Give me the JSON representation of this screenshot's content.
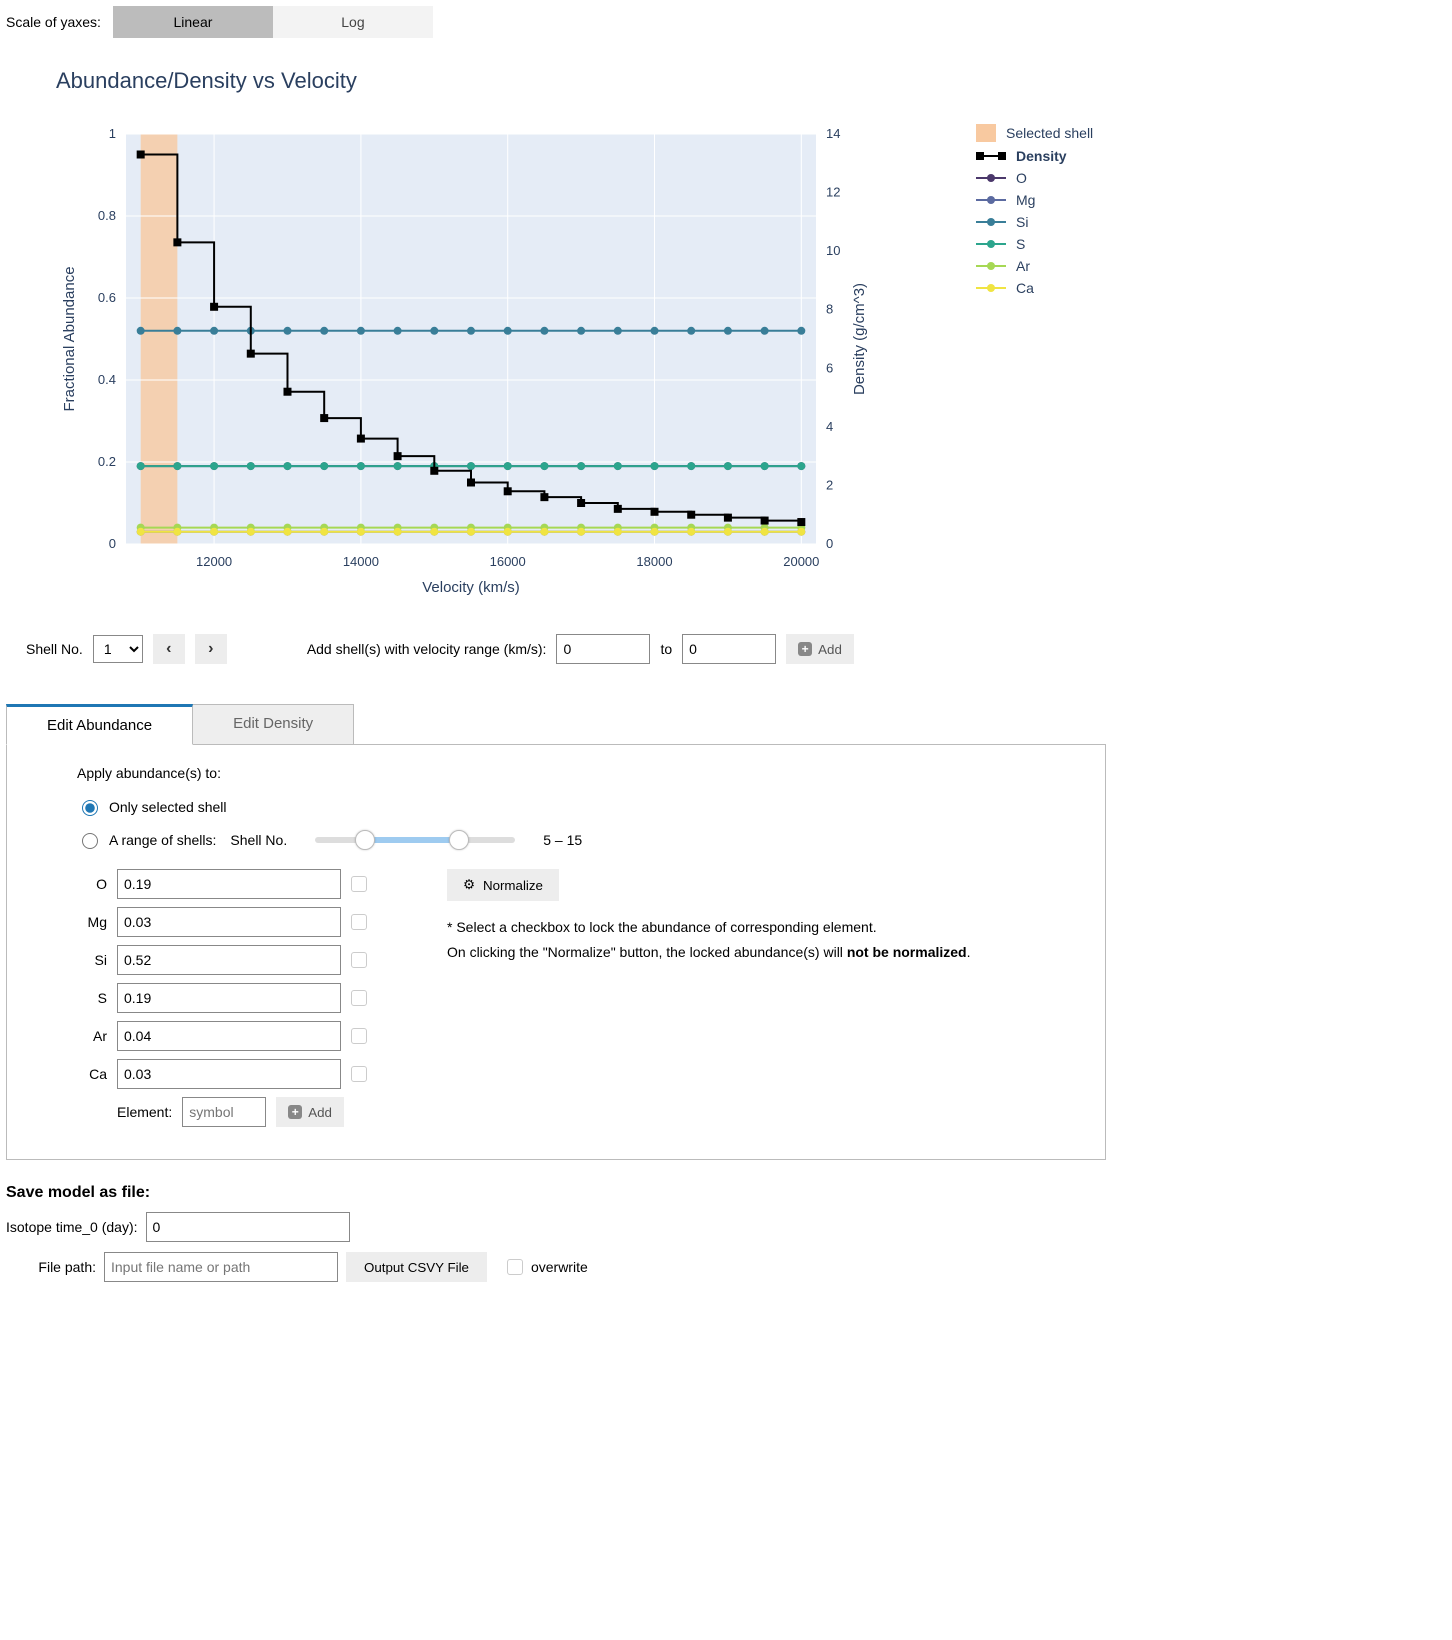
{
  "scale": {
    "label": "Scale of yaxes:",
    "options": [
      "Linear",
      "Log"
    ],
    "active": 0
  },
  "chart": {
    "title": "Abundance/Density vs Velocity",
    "xlabel": "Velocity (km/s)",
    "ylabel_left": "Fractional Abundance",
    "ylabel_right": "Density (g/cm^3)"
  },
  "legend": {
    "selected_shell": "Selected shell",
    "density": "Density",
    "elements": [
      {
        "name": "O",
        "color": "#4b386b"
      },
      {
        "name": "Mg",
        "color": "#5b6aa0"
      },
      {
        "name": "Si",
        "color": "#397e98"
      },
      {
        "name": "S",
        "color": "#2ca58d"
      },
      {
        "name": "Ar",
        "color": "#a6d854"
      },
      {
        "name": "Ca",
        "color": "#f0e442"
      }
    ]
  },
  "shell_controls": {
    "label": "Shell No.",
    "value": "1",
    "add_label": "Add shell(s) with velocity range (km/s):",
    "to": "to",
    "from_val": "0",
    "to_val": "0",
    "add_btn": "Add"
  },
  "tabs": {
    "items": [
      "Edit Abundance",
      "Edit Density"
    ],
    "active": 0
  },
  "edit": {
    "apply_label": "Apply abundance(s) to:",
    "opt_only": "Only selected shell",
    "opt_range": "A range of shells:",
    "range_shell_label": "Shell No.",
    "range_text": "5 – 15",
    "normalize": "Normalize",
    "hint_line1": "* Select a checkbox to lock the abundance of corresponding element.",
    "hint_line2a": "On clicking the \"Normalize\" button, the locked abundance(s) will ",
    "hint_line2b": "not be normalized",
    "hint_line2c": ".",
    "abundances": [
      {
        "el": "O",
        "val": "0.19"
      },
      {
        "el": "Mg",
        "val": "0.03"
      },
      {
        "el": "Si",
        "val": "0.52"
      },
      {
        "el": "S",
        "val": "0.19"
      },
      {
        "el": "Ar",
        "val": "0.04"
      },
      {
        "el": "Ca",
        "val": "0.03"
      }
    ],
    "add_el_label": "Element:",
    "add_el_placeholder": "symbol",
    "add_el_btn": "Add"
  },
  "save": {
    "title": "Save model as file:",
    "isotope_label": "Isotope time_0 (day):",
    "isotope_val": "0",
    "filepath_label": "File path:",
    "filepath_placeholder": "Input file name or path",
    "output_btn": "Output CSVY File",
    "overwrite": "overwrite"
  },
  "chart_data": {
    "type": "line",
    "xlabel": "Velocity (km/s)",
    "ylabel_left": "Fractional Abundance",
    "ylabel_right": "Density (g/cm^3)",
    "xlim": [
      10800,
      20200
    ],
    "ylim_left": [
      0,
      1
    ],
    "ylim_right": [
      0,
      14
    ],
    "x_ticks": [
      12000,
      14000,
      16000,
      18000,
      20000
    ],
    "y_left_ticks": [
      0,
      0.2,
      0.4,
      0.6,
      0.8,
      1
    ],
    "y_right_ticks": [
      0,
      2,
      4,
      6,
      8,
      10,
      12,
      14
    ],
    "selected_shell_x_range": [
      11000,
      11500
    ],
    "x": [
      11000,
      11500,
      12000,
      12500,
      13000,
      13500,
      14000,
      14500,
      15000,
      15500,
      16000,
      16500,
      17000,
      17500,
      18000,
      18500,
      19000,
      19500,
      20000
    ],
    "series_left": [
      {
        "name": "O",
        "color": "#4b386b",
        "values": [
          0.19,
          0.19,
          0.19,
          0.19,
          0.19,
          0.19,
          0.19,
          0.19,
          0.19,
          0.19,
          0.19,
          0.19,
          0.19,
          0.19,
          0.19,
          0.19,
          0.19,
          0.19,
          0.19
        ]
      },
      {
        "name": "Mg",
        "color": "#5b6aa0",
        "values": [
          0.03,
          0.03,
          0.03,
          0.03,
          0.03,
          0.03,
          0.03,
          0.03,
          0.03,
          0.03,
          0.03,
          0.03,
          0.03,
          0.03,
          0.03,
          0.03,
          0.03,
          0.03,
          0.03
        ]
      },
      {
        "name": "Si",
        "color": "#397e98",
        "values": [
          0.52,
          0.52,
          0.52,
          0.52,
          0.52,
          0.52,
          0.52,
          0.52,
          0.52,
          0.52,
          0.52,
          0.52,
          0.52,
          0.52,
          0.52,
          0.52,
          0.52,
          0.52,
          0.52
        ]
      },
      {
        "name": "S",
        "color": "#2ca58d",
        "values": [
          0.19,
          0.19,
          0.19,
          0.19,
          0.19,
          0.19,
          0.19,
          0.19,
          0.19,
          0.19,
          0.19,
          0.19,
          0.19,
          0.19,
          0.19,
          0.19,
          0.19,
          0.19,
          0.19
        ]
      },
      {
        "name": "Ar",
        "color": "#a6d854",
        "values": [
          0.04,
          0.04,
          0.04,
          0.04,
          0.04,
          0.04,
          0.04,
          0.04,
          0.04,
          0.04,
          0.04,
          0.04,
          0.04,
          0.04,
          0.04,
          0.04,
          0.04,
          0.04,
          0.04
        ]
      },
      {
        "name": "Ca",
        "color": "#f0e442",
        "values": [
          0.03,
          0.03,
          0.03,
          0.03,
          0.03,
          0.03,
          0.03,
          0.03,
          0.03,
          0.03,
          0.03,
          0.03,
          0.03,
          0.03,
          0.03,
          0.03,
          0.03,
          0.03,
          0.03
        ]
      }
    ],
    "series_right": [
      {
        "name": "Density",
        "color": "#000000",
        "step": true,
        "values": [
          13.3,
          10.3,
          8.1,
          6.5,
          5.2,
          4.3,
          3.6,
          3.0,
          2.5,
          2.1,
          1.8,
          1.6,
          1.4,
          1.2,
          1.1,
          1.0,
          0.9,
          0.8,
          0.75
        ]
      }
    ]
  }
}
